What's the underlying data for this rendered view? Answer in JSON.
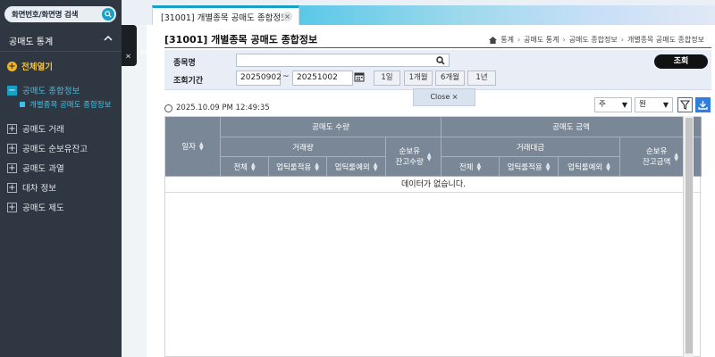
{
  "sidebar": {
    "search_label": "화면번호/화면명 검색",
    "section_title": "공매도 통계",
    "open_all": "전체열기",
    "items": [
      {
        "label": "공매도 종합정보",
        "expanded": true
      },
      {
        "label": "공매도 거래",
        "expanded": false
      },
      {
        "label": "공매도 순보유잔고",
        "expanded": false
      },
      {
        "label": "공매도 과열",
        "expanded": false
      },
      {
        "label": "대차 정보",
        "expanded": false
      },
      {
        "label": "공매도 제도",
        "expanded": false
      }
    ],
    "sub_item": "개별종목 공매도 종합정보",
    "close_tab": "Close"
  },
  "tab": {
    "label": "[31001] 개별종목 공매도 종합정보"
  },
  "page": {
    "title": "[31001] 개별종목 공매도 종합정보",
    "breadcrumb": [
      "통계",
      "공매도 통계",
      "공매도 종합정보",
      "개별종목 공매도 종합정보"
    ]
  },
  "filter": {
    "stock_label": "종목명",
    "stock_value": "",
    "period_label": "조회기간",
    "date_from": "20250902",
    "tilde": "~",
    "date_to": "20251002",
    "periods": [
      "1일",
      "1개월",
      "6개월",
      "1년"
    ],
    "search_button": "조회",
    "close_popup": "Close"
  },
  "toolbar": {
    "timestamp": "2025.10.09 PM 12:49:35",
    "unit_period": "주",
    "unit_currency": "원"
  },
  "table": {
    "col_date": "일자",
    "group_qty": "공매도 수량",
    "group_amt": "공매도 금액",
    "sub_volume": "거래량",
    "sub_value": "거래대금",
    "net_qty": [
      "순보유",
      "잔고수량"
    ],
    "net_amt": [
      "순보유",
      "잔고금액"
    ],
    "col_total": "전체",
    "col_uptick": "업틱룰적용",
    "col_except": "업틱룰예외",
    "empty": "데이터가 없습니다."
  },
  "colors": {
    "accent": "#17a1c6",
    "sidebar_bg": "#2f3842",
    "header_bg": "#7a8796",
    "filter_bg": "#e8edf6"
  }
}
